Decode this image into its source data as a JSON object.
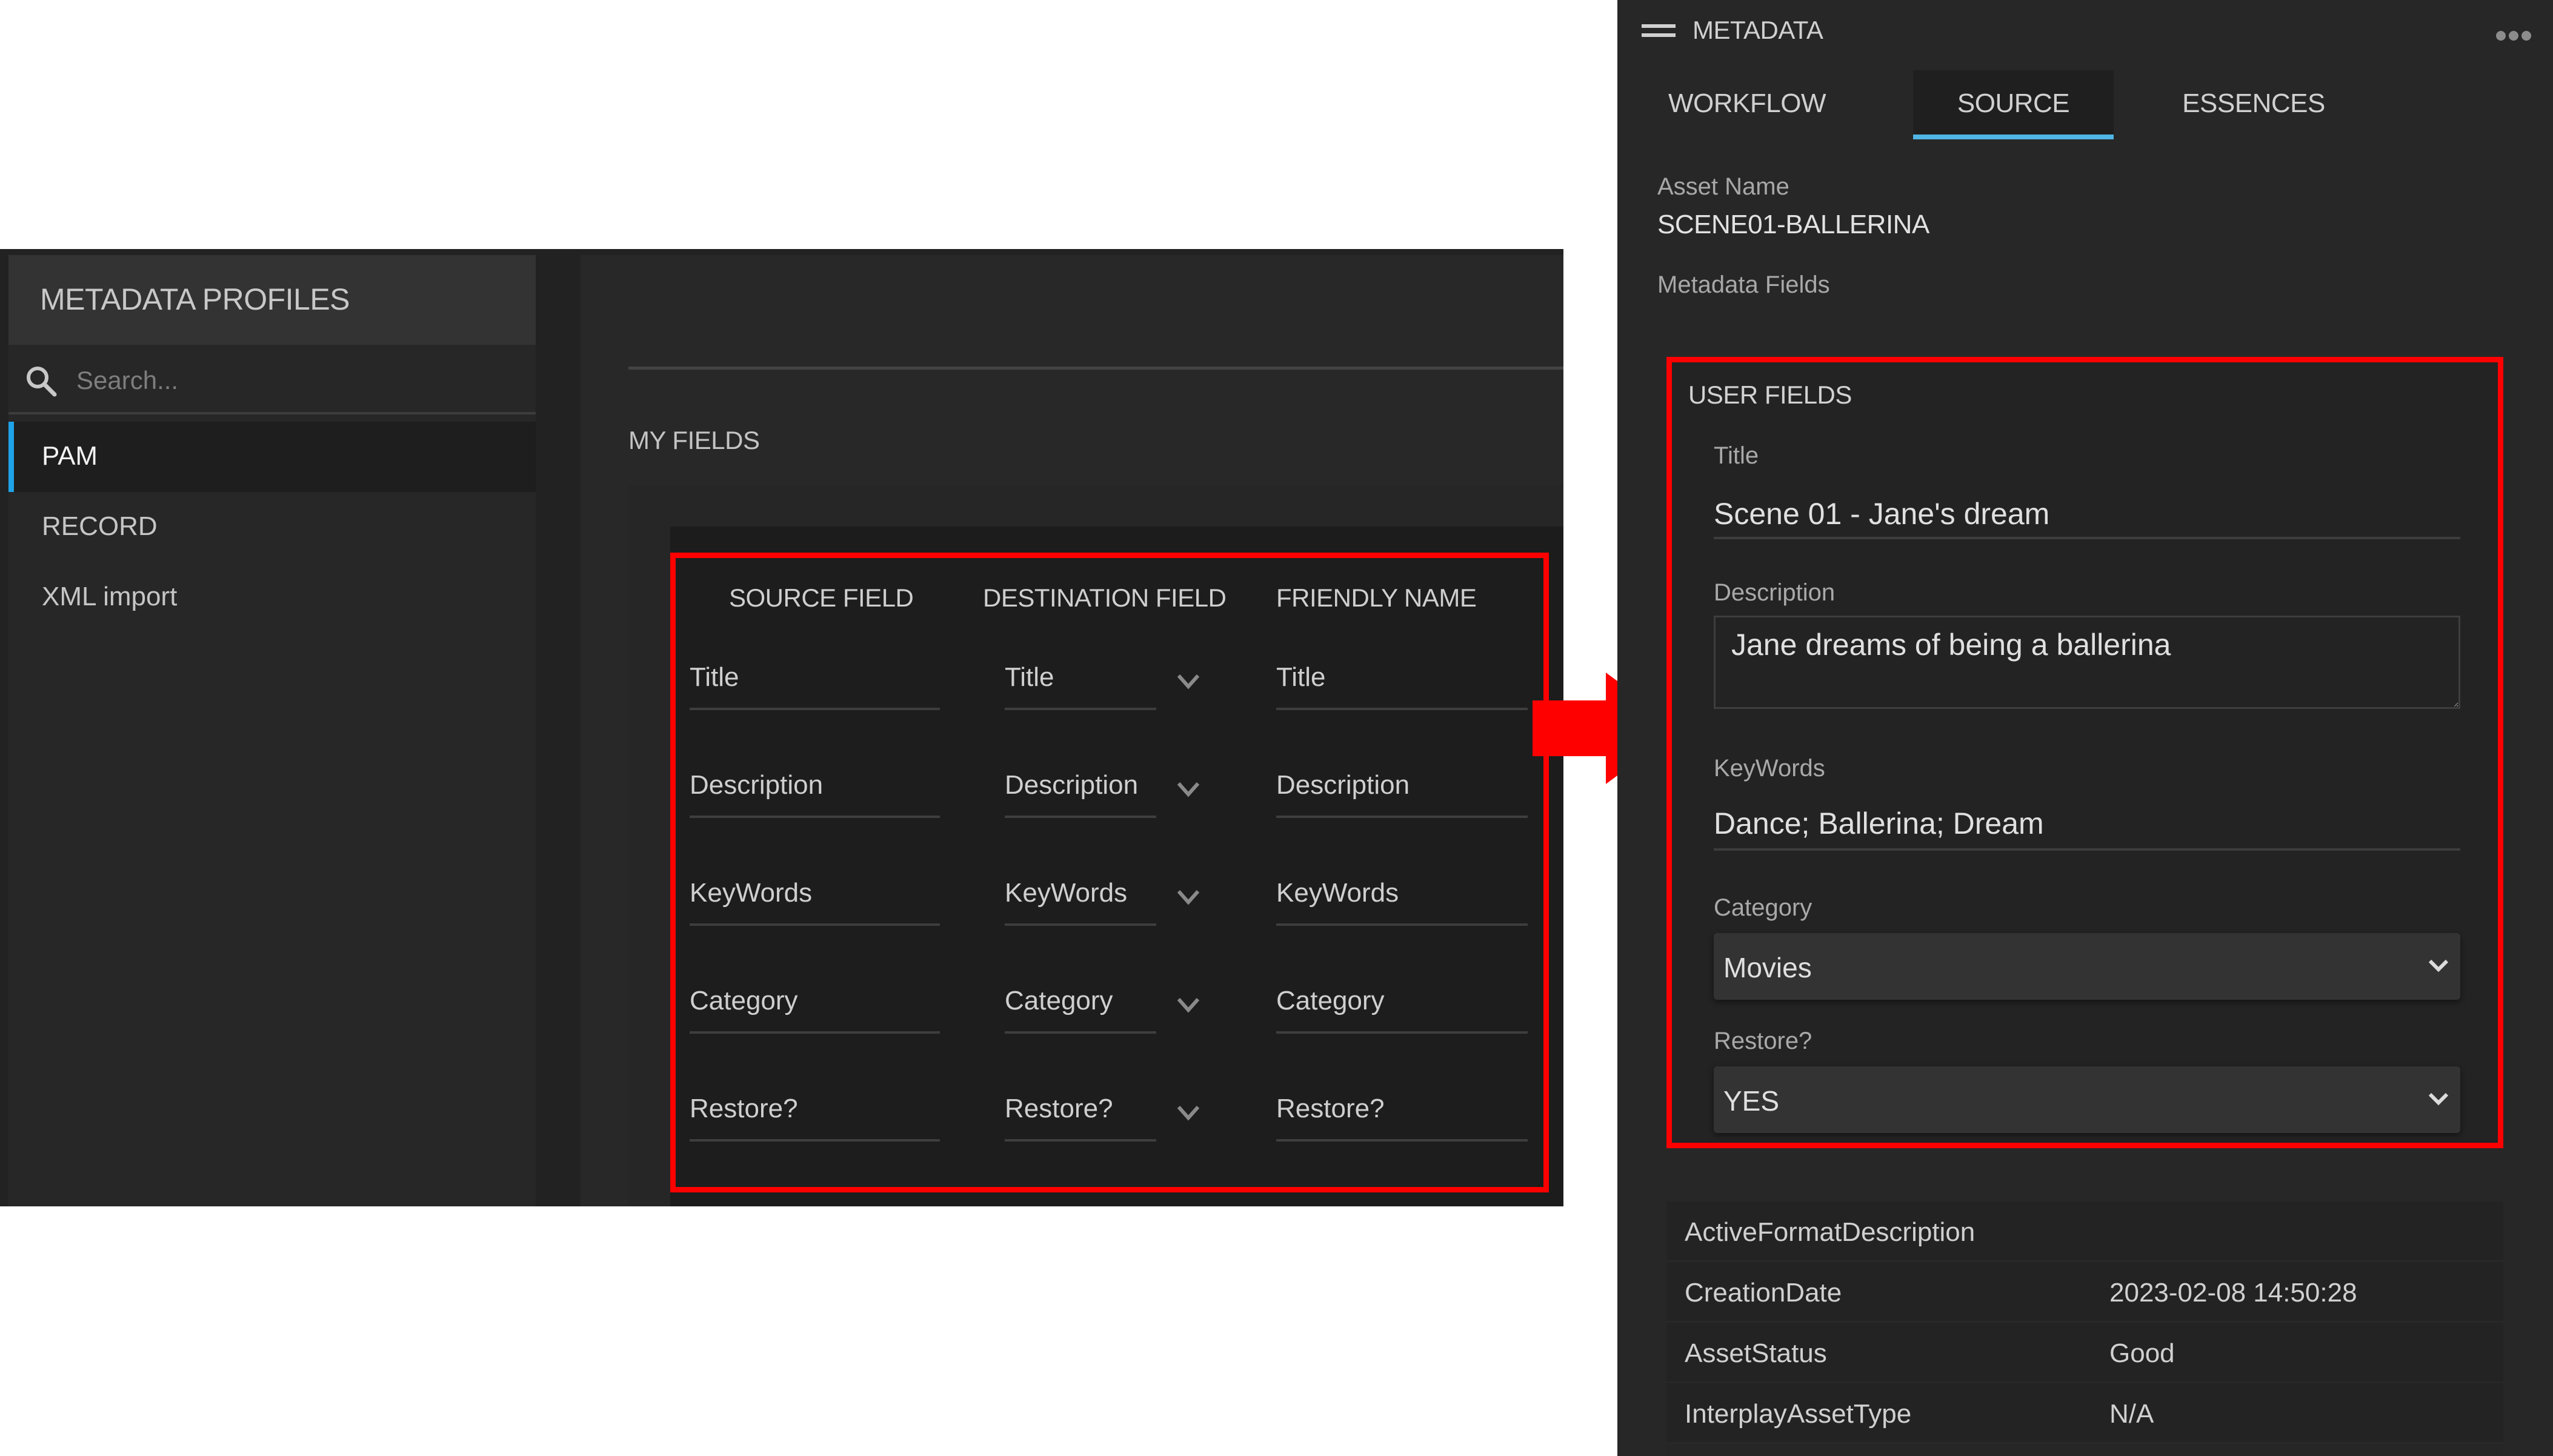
{
  "profiles_window": {
    "sidebar": {
      "title": "METADATA PROFILES",
      "search": {
        "placeholder": "Search...",
        "value": ""
      },
      "items": [
        {
          "label": "PAM",
          "active": true
        },
        {
          "label": "RECORD",
          "active": false
        },
        {
          "label": "XML import",
          "active": false
        }
      ]
    },
    "main": {
      "section_title": "MY FIELDS",
      "table": {
        "columns": [
          "SOURCE FIELD",
          "DESTINATION FIELD",
          "FRIENDLY NAME"
        ],
        "rows": [
          {
            "source": "Title",
            "destination": "Title",
            "friendly": "Title"
          },
          {
            "source": "Description",
            "destination": "Description",
            "friendly": "Description"
          },
          {
            "source": "KeyWords",
            "destination": "KeyWords",
            "friendly": "KeyWords"
          },
          {
            "source": "Category",
            "destination": "Category",
            "friendly": "Category"
          },
          {
            "source": "Restore?",
            "destination": "Restore?",
            "friendly": "Restore?"
          }
        ]
      }
    }
  },
  "annotation": {
    "highlight_color": "#ff0000",
    "arrow_direction": "right"
  },
  "metadata_panel": {
    "title": "METADATA",
    "tabs": [
      {
        "label": "WORKFLOW",
        "active": false
      },
      {
        "label": "SOURCE",
        "active": true
      },
      {
        "label": "ESSENCES",
        "active": false
      }
    ],
    "accent_color": "#4fb6e6",
    "asset_name_label": "Asset Name",
    "asset_name": "SCENE01-BALLERINA",
    "metadata_fields_label": "Metadata Fields",
    "user_fields": {
      "title": "USER FIELDS",
      "title_field": {
        "label": "Title",
        "value": "Scene 01 - Jane's dream"
      },
      "description_field": {
        "label": "Description",
        "value": "Jane dreams of being a ballerina"
      },
      "keywords_field": {
        "label": "KeyWords",
        "value": "Dance; Ballerina; Dream"
      },
      "category_field": {
        "label": "Category",
        "selected": "Movies"
      },
      "restore_field": {
        "label": "Restore?",
        "selected": "YES"
      }
    },
    "properties": [
      {
        "key": "ActiveFormatDescription",
        "value": ""
      },
      {
        "key": "CreationDate",
        "value": "2023-02-08 14:50:28"
      },
      {
        "key": "AssetStatus",
        "value": "Good"
      },
      {
        "key": "InterplayAssetType",
        "value": "N/A"
      }
    ]
  }
}
